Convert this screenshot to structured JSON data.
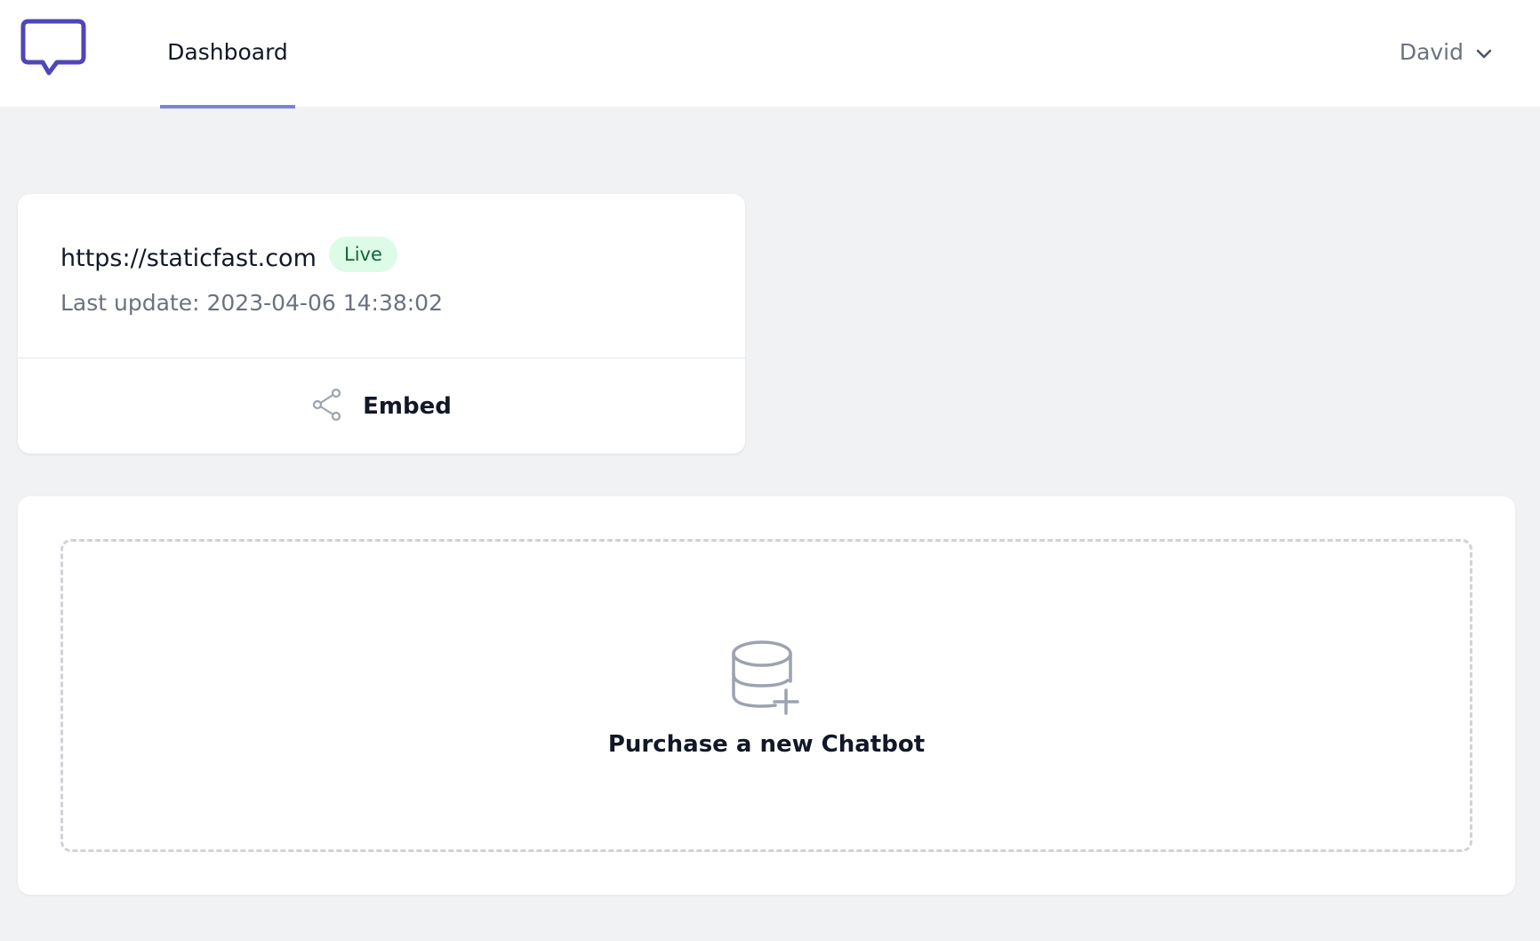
{
  "header": {
    "logo_icon": "chat-bubble-icon",
    "nav_tab_label": "Dashboard",
    "user_name": "David",
    "user_menu_icon": "chevron-down-icon",
    "accent_color": "#4f46b8",
    "tab_underline_color": "#7b83d9"
  },
  "site_card": {
    "url": "https://staticfast.com",
    "status_badge": "Live",
    "status_color": "#dcfce7",
    "last_update": "Last update: 2023-04-06 14:38:02",
    "embed_label": "Embed",
    "embed_icon": "share-icon"
  },
  "purchase": {
    "label": "Purchase a new Chatbot",
    "icon": "database-plus-icon"
  }
}
